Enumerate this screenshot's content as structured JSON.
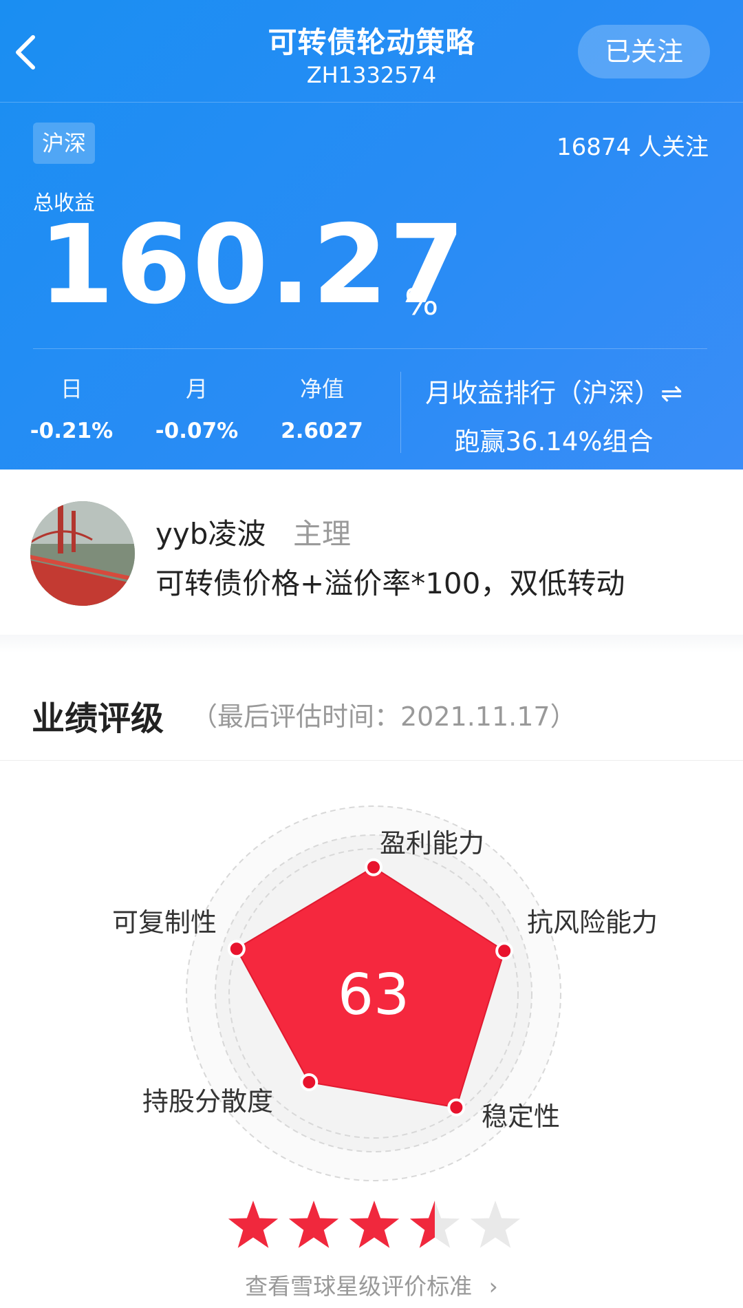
{
  "header": {
    "title": "可转债轮动策略",
    "code": "ZH1332574",
    "follow_label": "已关注"
  },
  "summary": {
    "market_tag": "沪深",
    "followers": "16874 人关注",
    "total_label": "总收益",
    "total_value": "160.27",
    "total_unit": "%",
    "stats": [
      {
        "label": "日",
        "value": "-0.21%"
      },
      {
        "label": "月",
        "value": "-0.07%"
      },
      {
        "label": "净值",
        "value": "2.6027"
      }
    ],
    "rank_title": "月收益排行（沪深）⇌",
    "rank_desc": "跑赢36.14%组合"
  },
  "owner": {
    "name": "yyb凌波",
    "role": "主理",
    "description": "可转债价格+溢价率*100，双低转动"
  },
  "performance": {
    "title": "业绩评级",
    "date": "（最后评估时间：2021.11.17）",
    "score": "63",
    "dimensions": [
      {
        "label": "盈利能力",
        "level": 0.77
      },
      {
        "label": "抗风险能力",
        "level": 0.84
      },
      {
        "label": "稳定性",
        "level": 0.86
      },
      {
        "label": "持股分散度",
        "level": 0.67
      },
      {
        "label": "可复制性",
        "level": 0.88
      }
    ],
    "stars": 3.5,
    "stars_max": 5,
    "criteria_link": "查看雪球星级评价标准"
  },
  "colors": {
    "brand_blue": "#1a8ef2",
    "radar_red": "#f5283e",
    "star_red": "#f0283d",
    "star_grey": "#e9e9e9"
  }
}
